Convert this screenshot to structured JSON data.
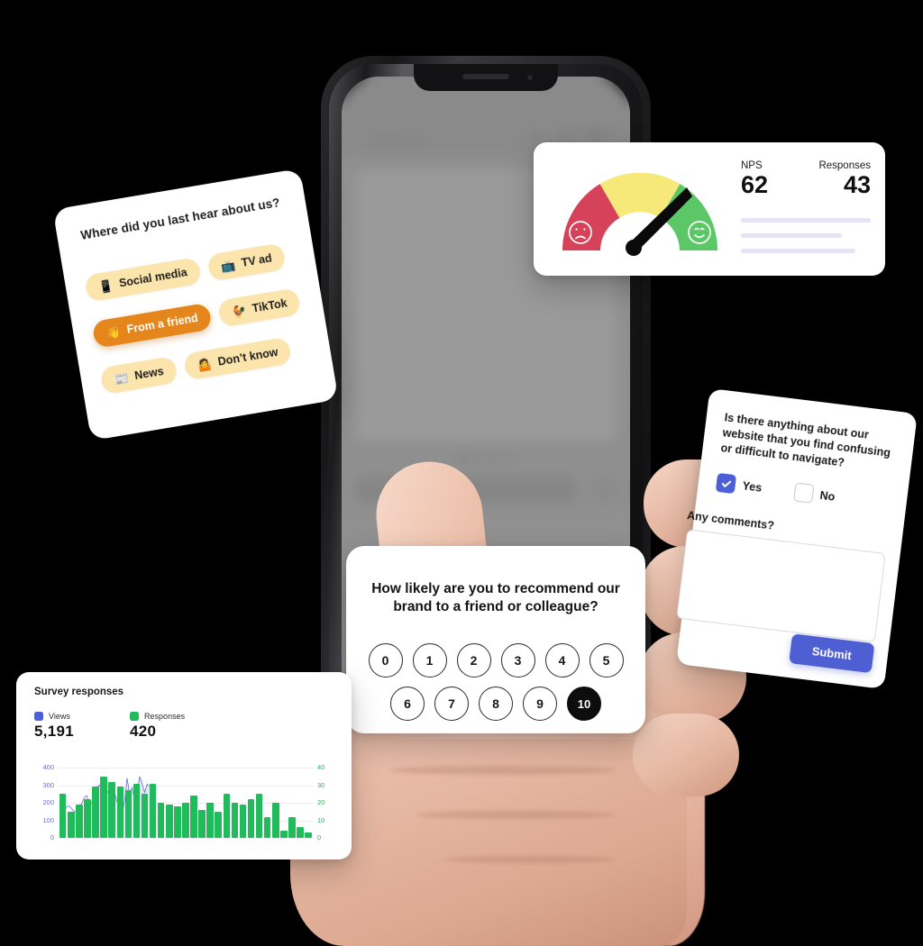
{
  "phone_screen": {
    "logo_name": "brand-squiggle-logo",
    "icons": [
      "user-icon",
      "cart-icon",
      "hamburger-menu-icon"
    ],
    "carousel_dots": 4
  },
  "hear_card": {
    "question": "Where did you last hear about us?",
    "options": [
      {
        "label": "Social media",
        "emoji": "📱",
        "selected": false
      },
      {
        "label": "TV ad",
        "emoji": "📺",
        "selected": false
      },
      {
        "label": "From a friend",
        "emoji": "👋",
        "selected": true
      },
      {
        "label": "TikTok",
        "emoji": "🐓",
        "selected": false
      },
      {
        "label": "News",
        "emoji": "📰",
        "selected": false
      },
      {
        "label": "Don’t know",
        "emoji": "🤷",
        "selected": false
      }
    ],
    "pill_bg": "#fbe5ad",
    "pill_selected_bg": "#e4861c"
  },
  "nps_card": {
    "nps_label": "NPS",
    "nps_value": "62",
    "responses_label": "Responses",
    "responses_value": "43",
    "gauge": {
      "zones": [
        "detractor-red",
        "passive-yellow",
        "promoter-green"
      ],
      "red": "#d6425a",
      "yellow": "#f7e87a",
      "green": "#5cc767",
      "needle_color": "#0a0a0a",
      "needle_angle_deg": 52,
      "left_face": "sad-face-icon",
      "right_face": "happy-face-icon"
    },
    "placeholder_line_color": "#e5e4f6"
  },
  "nps_question_card": {
    "question": "How likely are you to recommend our brand to a friend or colleague?",
    "scale_row_1": [
      "0",
      "1",
      "2",
      "3",
      "4",
      "5"
    ],
    "scale_row_2": [
      "6",
      "7",
      "8",
      "9",
      "10"
    ],
    "selected": "10"
  },
  "feedback_card": {
    "question": "Is there anything about our website that you find confusing or difficult to navigate?",
    "yes_label": "Yes",
    "no_label": "No",
    "yes_checked": true,
    "no_checked": false,
    "comments_label": "Any comments?",
    "comments_value": "",
    "submit_label": "Submit",
    "accent": "#4e5fd4"
  },
  "chart_card": {
    "title": "Survey responses",
    "views_label": "Views",
    "views_value": "5,191",
    "responses_label": "Responses",
    "responses_value": "420",
    "views_color": "#4c5fd7",
    "responses_color": "#22bb5b"
  },
  "chart_data": {
    "type": "bar",
    "title": "Survey responses",
    "xlabel": "",
    "ylabel": "",
    "grid": true,
    "legend": "top-left",
    "y_left": {
      "label": "Views",
      "ticks": [
        0,
        100,
        200,
        300,
        400
      ],
      "ylim": [
        0,
        400
      ],
      "color": "#6a6ed0"
    },
    "y_right": {
      "label": "Responses",
      "ticks": [
        0,
        10,
        20,
        30,
        40
      ],
      "ylim": [
        0,
        40
      ],
      "color": "#2bb35f"
    },
    "series": [
      {
        "name": "Responses",
        "type": "bar",
        "axis": "right",
        "color": "#22bb5b",
        "values": [
          25,
          15,
          19,
          22,
          29,
          35,
          32,
          29,
          27,
          31,
          25,
          31,
          20,
          19,
          18,
          20,
          24,
          16,
          20,
          15,
          25,
          20,
          19,
          22,
          25,
          12,
          20,
          4,
          12,
          6,
          3
        ]
      },
      {
        "name": "Views",
        "type": "area",
        "axis": "left",
        "color": "#6a6ed0",
        "fill": "#e4e5f8",
        "values": [
          250,
          205,
          160,
          180,
          180,
          165,
          148,
          150,
          175,
          200,
          230,
          240,
          180,
          205,
          260,
          290,
          300,
          275,
          285,
          270,
          240,
          250,
          260,
          205,
          180,
          140,
          210,
          340,
          250,
          285,
          215,
          250,
          350,
          310,
          260,
          305,
          295
        ]
      }
    ]
  }
}
